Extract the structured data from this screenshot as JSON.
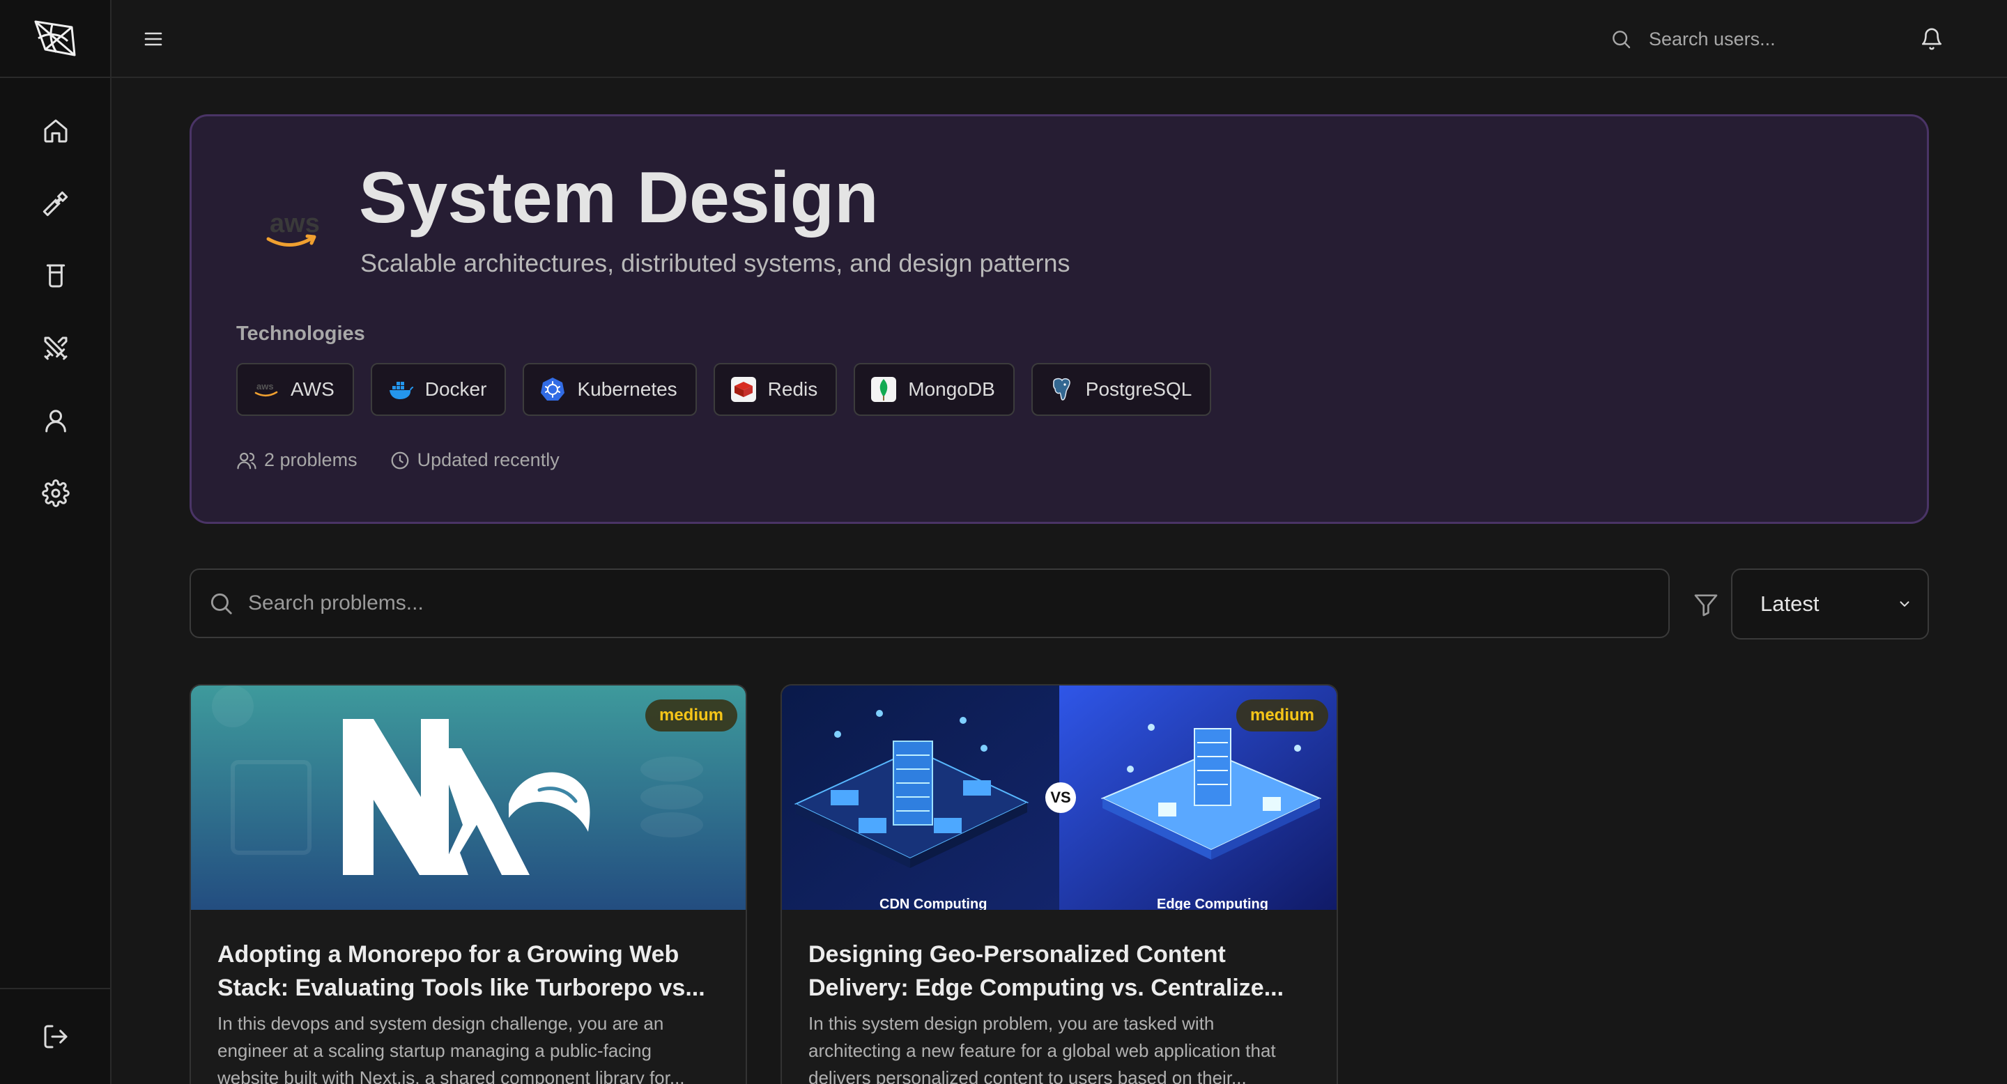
{
  "topbar": {
    "search_placeholder": "Search users..."
  },
  "sidebar": {
    "items": [
      {
        "icon": "home-icon"
      },
      {
        "icon": "hammer-icon"
      },
      {
        "icon": "beaker-icon"
      },
      {
        "icon": "crossed-swords-icon"
      },
      {
        "icon": "user-icon"
      },
      {
        "icon": "gear-icon"
      }
    ],
    "logout_icon": "logout-icon"
  },
  "hero": {
    "title": "System Design",
    "subtitle": "Scalable architectures, distributed systems, and design patterns",
    "technologies_label": "Technologies",
    "technologies": [
      {
        "name": "AWS",
        "icon": "aws-icon"
      },
      {
        "name": "Docker",
        "icon": "docker-icon"
      },
      {
        "name": "Kubernetes",
        "icon": "kubernetes-icon"
      },
      {
        "name": "Redis",
        "icon": "redis-icon"
      },
      {
        "name": "MongoDB",
        "icon": "mongodb-icon"
      },
      {
        "name": "PostgreSQL",
        "icon": "postgresql-icon"
      }
    ],
    "problem_count": "2 problems",
    "updated": "Updated recently"
  },
  "controls": {
    "search_placeholder": "Search problems...",
    "sort_value": "Latest"
  },
  "cards": [
    {
      "badge": "medium",
      "title_line1": "Adopting a Monorepo for a Growing Web",
      "title_line2": "Stack: Evaluating Tools like Turborepo vs...",
      "desc_line1": "In this devops and system design challenge, you are an",
      "desc_line2": "engineer at a scaling startup managing a public-facing",
      "desc_line3": "website built with Next.js, a shared component library for..."
    },
    {
      "badge": "medium",
      "title_line1": "Designing Geo-Personalized Content",
      "title_line2": "Delivery: Edge Computing vs. Centralize...",
      "desc_line1": "In this system design problem, you are tasked with",
      "desc_line2": "architecting a new feature for a global web application that",
      "desc_line3": "delivers personalized content to users based on their...",
      "image_vs": "VS",
      "image_left_caption": "CDN Computing",
      "image_right_caption": "Edge Computing"
    }
  ],
  "colors": {
    "background": "#171717",
    "sidebar": "#111111",
    "hero_bg": "#261d33",
    "hero_border": "#4a3466",
    "badge_text": "#f5c518"
  }
}
